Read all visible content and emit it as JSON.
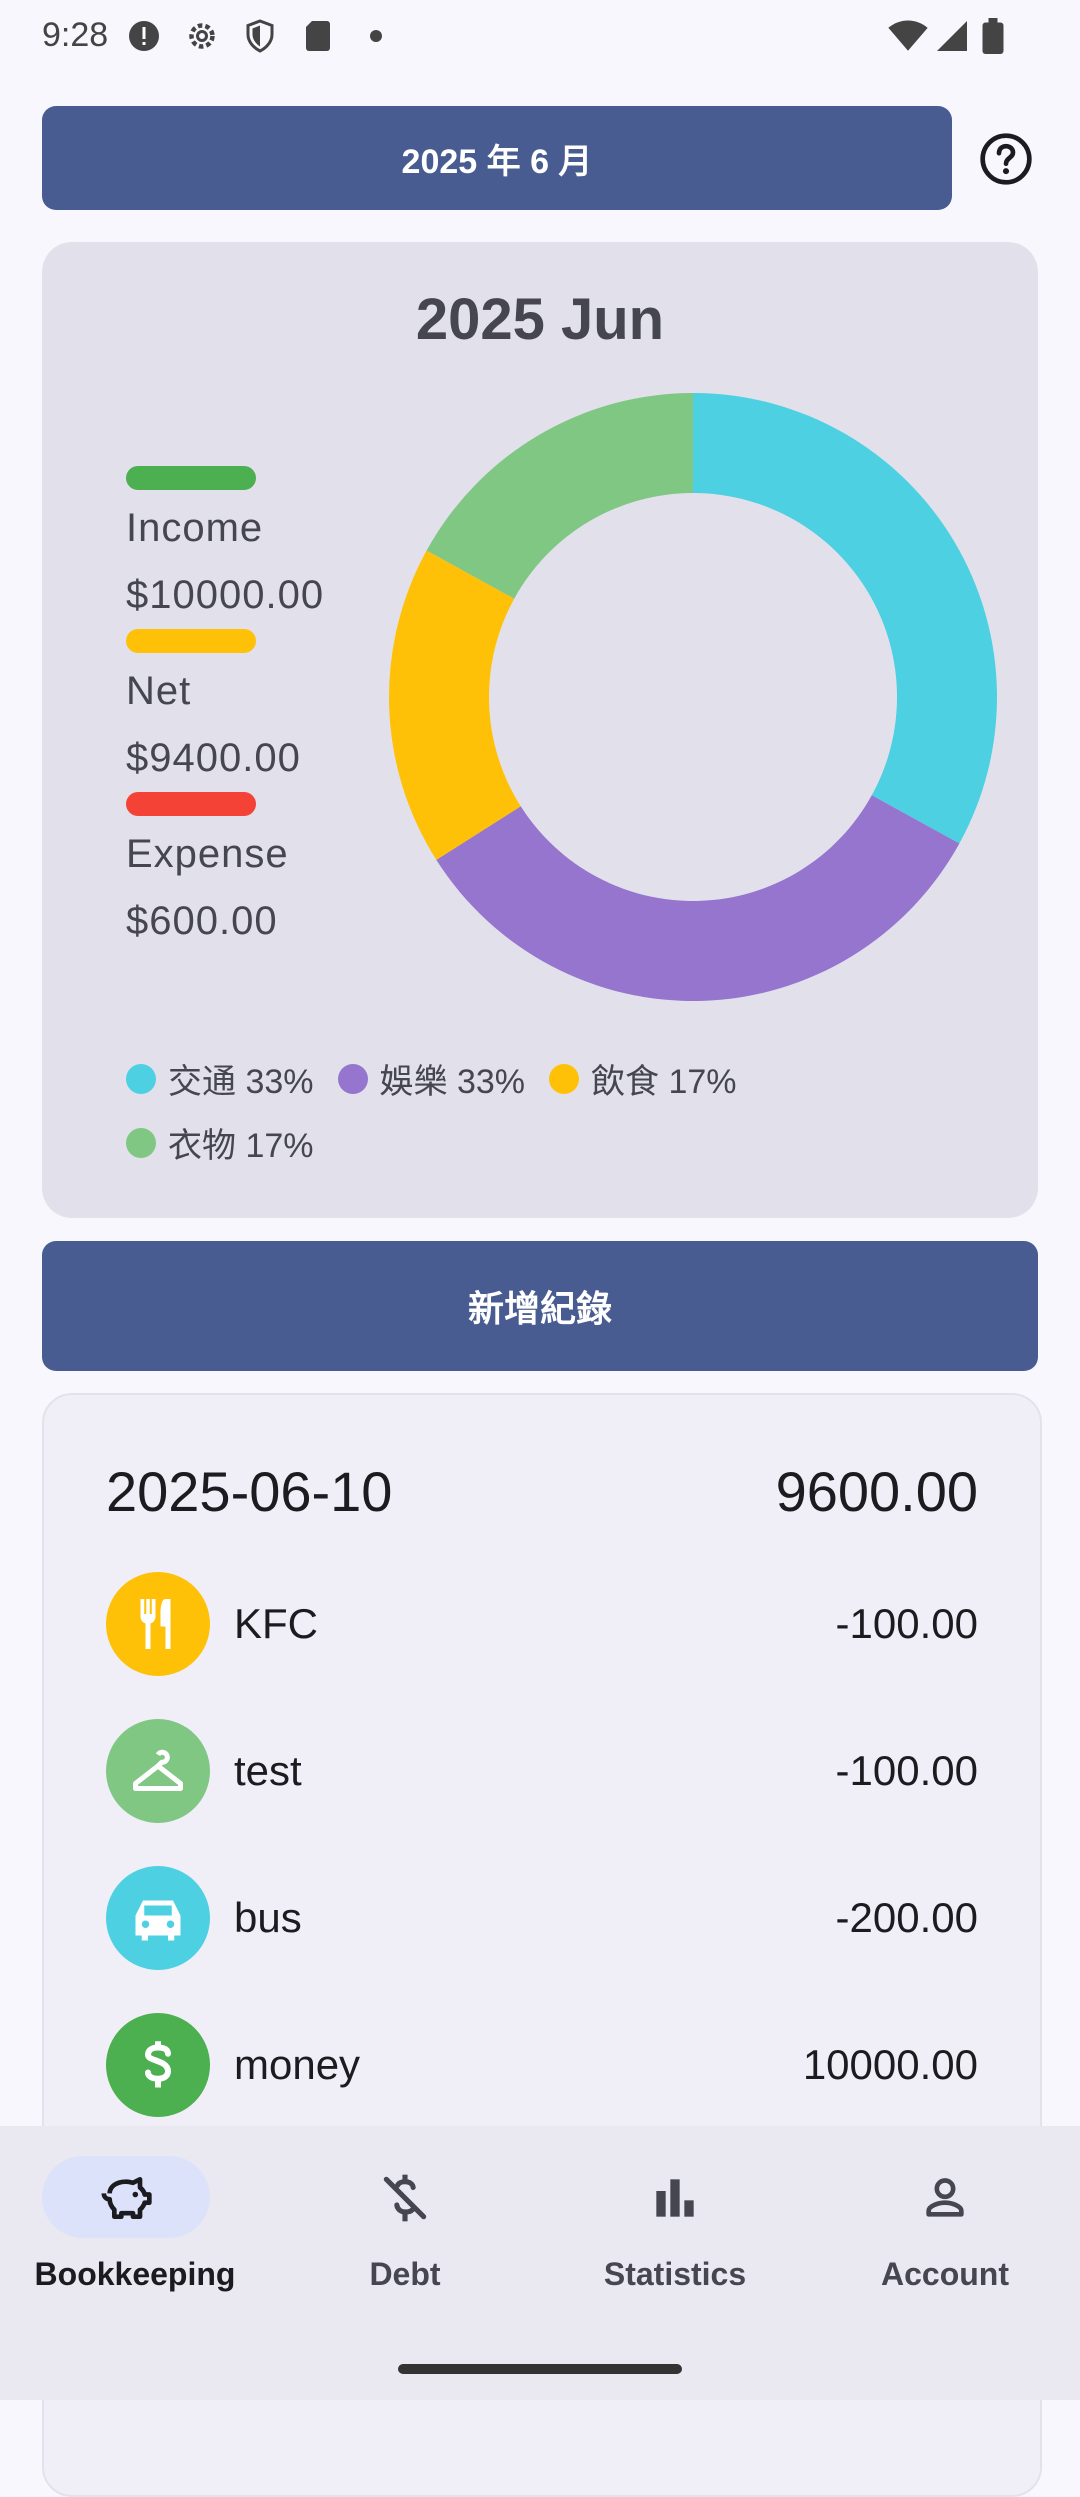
{
  "status_bar": {
    "time": "9:28"
  },
  "header": {
    "month_button": "2025 年 6 月",
    "help_icon": "help-circle-icon"
  },
  "summary": {
    "title": "2025 Jun",
    "legend": [
      {
        "label": "Income",
        "value": "$10000.00",
        "color": "#4CAF50"
      },
      {
        "label": "Net",
        "value": "$9400.00",
        "color": "#FFC107"
      },
      {
        "label": "Expense",
        "value": "$600.00",
        "color": "#F44336"
      }
    ],
    "categories": [
      {
        "label": "交通 33%",
        "percent": 33,
        "color": "#4DD0E1"
      },
      {
        "label": "娛樂 33%",
        "percent": 33,
        "color": "#9575CD"
      },
      {
        "label": "飲食 17%",
        "percent": 17,
        "color": "#FFC107"
      },
      {
        "label": "衣物 17%",
        "percent": 17,
        "color": "#81C784"
      }
    ]
  },
  "add_button": "新增紀錄",
  "records": {
    "date": "2025-06-10",
    "total": "9600.00",
    "items": [
      {
        "name": "KFC",
        "amount": "-100.00",
        "icon": "utensils-icon",
        "color": "#FFC107"
      },
      {
        "name": "test",
        "amount": "-100.00",
        "icon": "hanger-icon",
        "color": "#81C784"
      },
      {
        "name": "bus",
        "amount": "-200.00",
        "icon": "car-icon",
        "color": "#4DD0E1"
      },
      {
        "name": "money",
        "amount": "10000.00",
        "icon": "dollar-icon",
        "color": "#4CAF50"
      }
    ]
  },
  "bottom_nav": [
    {
      "label": "Bookkeeping",
      "icon": "piggy-bank-icon",
      "active": true
    },
    {
      "label": "Debt",
      "icon": "money-off-icon",
      "active": false
    },
    {
      "label": "Statistics",
      "icon": "bar-chart-icon",
      "active": false
    },
    {
      "label": "Account",
      "icon": "person-icon",
      "active": false
    }
  ]
}
